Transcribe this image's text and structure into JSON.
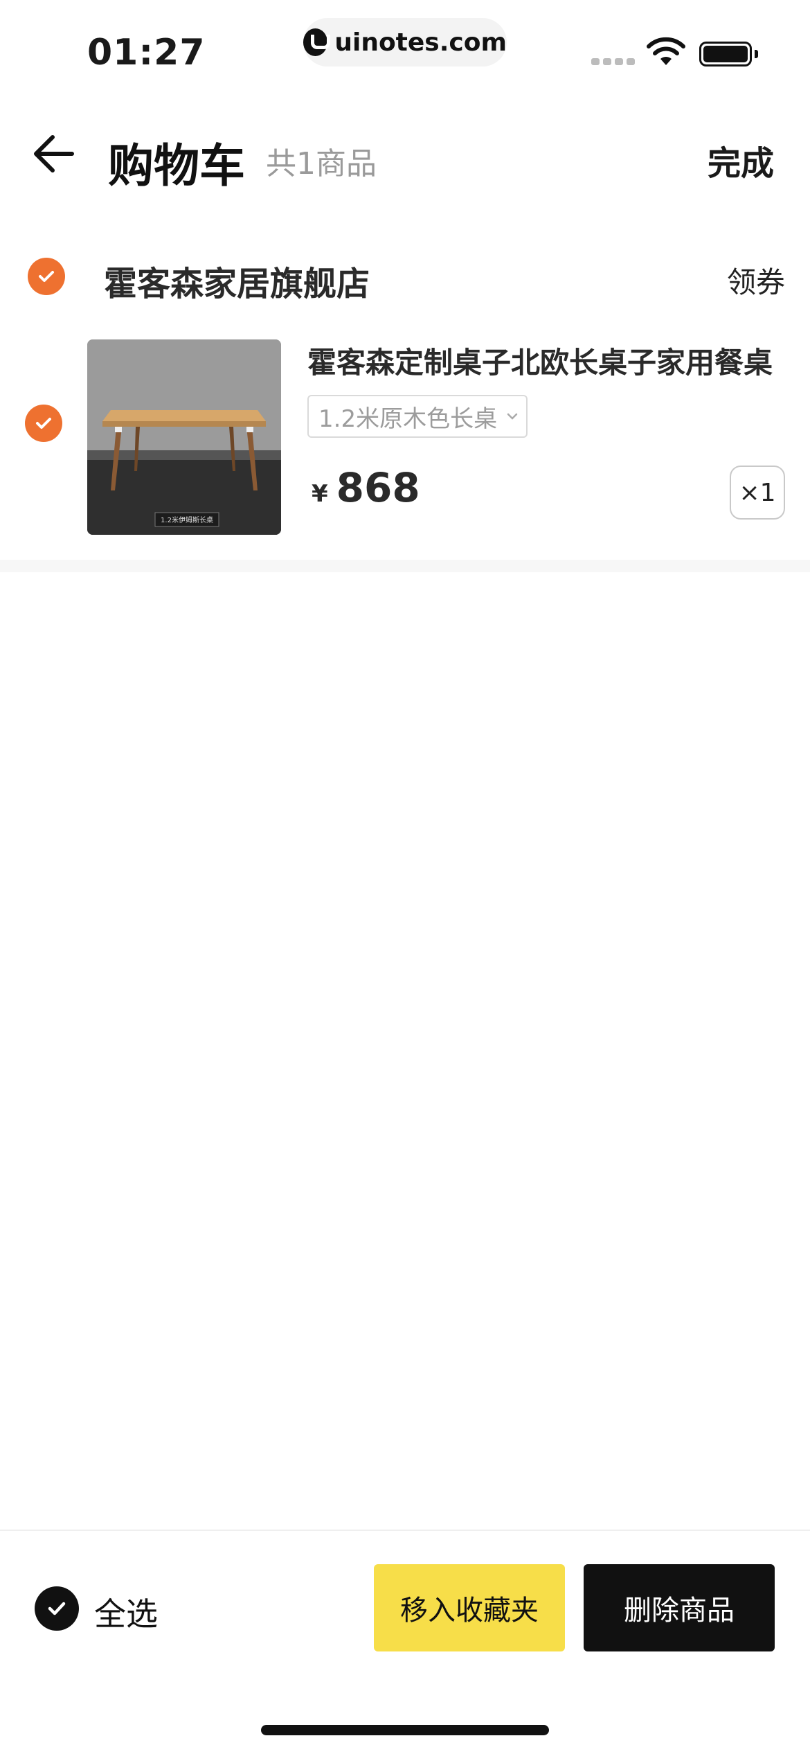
{
  "status_bar": {
    "time": "01:27",
    "url": "uinotes.com",
    "icons": [
      "signal-icon",
      "wifi-icon",
      "battery-icon"
    ]
  },
  "header": {
    "title": "购物车",
    "subtitle": "共1商品",
    "done_label": "完成",
    "back_icon": "back-arrow-icon"
  },
  "shop": {
    "name": "霍客森家居旗舰店",
    "coupon_label": "领券",
    "selected": true
  },
  "cart_item": {
    "name": "霍客森定制桌子北欧长桌子家用餐桌",
    "variant": "1.2米原木色长桌",
    "currency": "¥",
    "price": "868",
    "quantity_label": "×1",
    "selected": true,
    "image_caption": "1.2米伊姆斯长桌"
  },
  "bottom_bar": {
    "select_all_label": "全选",
    "favorite_label": "移入收藏夹",
    "delete_label": "删除商品"
  },
  "colors": {
    "accent_check": "#ee7130",
    "favorite_button": "#f7de49",
    "delete_button": "#111111"
  }
}
